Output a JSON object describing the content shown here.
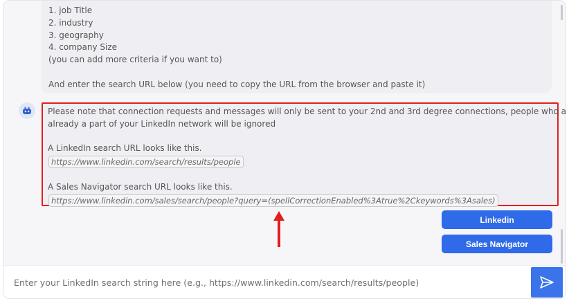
{
  "previous_message": {
    "lines": [
      "1. job Title",
      "2. industry",
      "3. geography",
      "4. company Size",
      "(you can add more criteria if you want to)",
      "",
      "And enter the search URL below (you need to copy the URL from the browser and paste it)"
    ]
  },
  "current_message": {
    "note_line1": "Please note that connection requests and messages will only be sent to your 2nd and 3rd degree connections, people who are",
    "note_line2": "already a part of your LinkedIn network will be ignored",
    "linkedin_caption": "A LinkedIn search URL looks like this.",
    "linkedin_url": "https://www.linkedin.com/search/results/people",
    "salesnav_caption": "A Sales Navigator search URL looks like this.",
    "salesnav_url": "https://www.linkedin.com/sales/search/people?query=(spellCorrectionEnabled%3Atrue%2Ckeywords%3Asales)"
  },
  "buttons": {
    "linkedin_label": "Linkedin",
    "salesnav_label": "Sales Navigator"
  },
  "input": {
    "placeholder": "Enter your LinkedIn search string here (e.g., https://www.linkedin.com/search/results/people)",
    "value": ""
  },
  "icons": {
    "avatar": "bot-icon",
    "send": "send-icon"
  },
  "colors": {
    "accent": "#2f6be8",
    "highlight": "#e01f1f",
    "bubble_bg": "#efeff3"
  }
}
